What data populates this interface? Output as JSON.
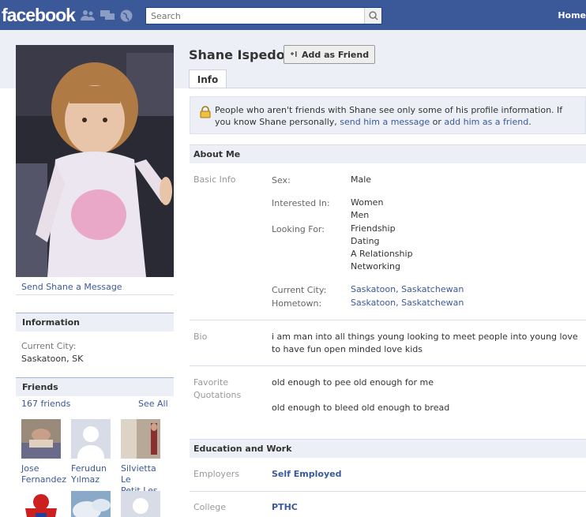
{
  "topbar": {
    "logo": "facebook",
    "search_placeholder": "Search",
    "home": "Home"
  },
  "profile": {
    "name": "Shane Ispedo",
    "add_friend": "Add as Friend",
    "send_message": "Send Shane a Message"
  },
  "tabs": [
    "Info"
  ],
  "notice": {
    "text_before": "People who aren't friends with Shane see only some of his profile information. If you know Shane personally, ",
    "send_link": "send him a message",
    "middle": " or ",
    "add_link": "add him as a friend",
    "end": "."
  },
  "left": {
    "information_title": "Information",
    "current_city_label": "Current City:",
    "current_city_value": "Saskatoon, SK",
    "friends_title": "Friends",
    "friends_count": "167 friends",
    "see_all": "See All",
    "friends": [
      {
        "first": "Jose",
        "last": "Fernandez"
      },
      {
        "first": "Ferudun",
        "last": "Yılmaz"
      },
      {
        "first": "Silvietta Le",
        "last": "Petit Les"
      }
    ]
  },
  "about": {
    "title": "About Me",
    "basic_info_label": "Basic Info",
    "sex_label": "Sex:",
    "sex_value": "Male",
    "interested_label": "Interested In:",
    "interested_values": [
      "Women",
      "Men"
    ],
    "looking_label": "Looking For:",
    "looking_values": [
      "Friendship",
      "Dating",
      "A Relationship",
      "Networking"
    ],
    "current_city_label": "Current City:",
    "current_city_value": "Saskatoon, Saskatchewan",
    "hometown_label": "Hometown:",
    "hometown_value": "Saskatoon, Saskatchewan",
    "bio_label": "Bio",
    "bio_text": "i am man into all things young looking to meet people into young love to have fun open minded love kids",
    "quotes_label_1": "Favorite",
    "quotes_label_2": "Quotations",
    "quote_1": "old enough to pee old enough for me",
    "quote_2": "old enough to bleed old enough to bread"
  },
  "education": {
    "title": "Education and Work",
    "employers_label": "Employers",
    "employers_value": "Self Employed",
    "college_label": "College",
    "college_value": "PTHC"
  },
  "colors": {
    "brand": "#3b5998",
    "band": "#eceff5",
    "link": "#3b5998"
  }
}
